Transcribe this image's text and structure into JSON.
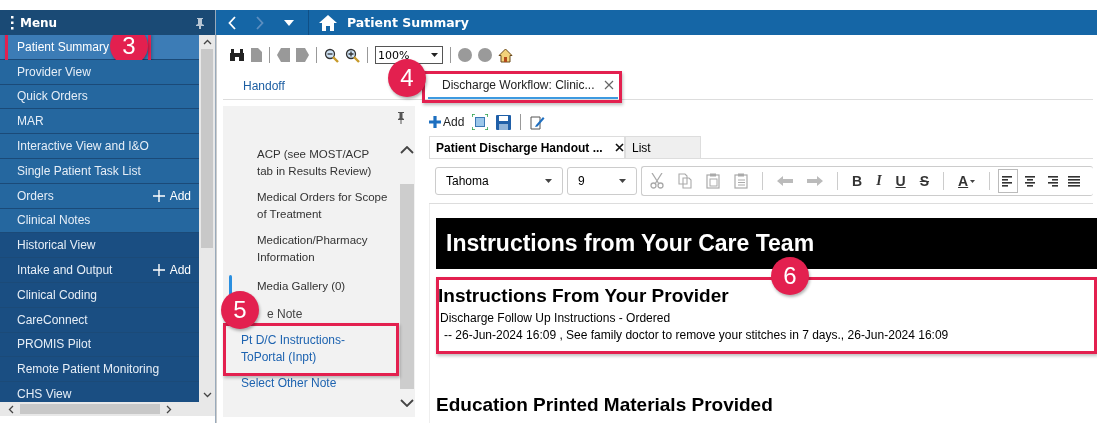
{
  "menu": {
    "title": "Menu",
    "items": [
      {
        "label": "Patient Summary",
        "selected": true,
        "kind": "primary",
        "callout": "3"
      },
      {
        "label": "Provider View",
        "selected": false,
        "kind": "primary"
      },
      {
        "label": "Quick Orders",
        "selected": false,
        "kind": "primary"
      },
      {
        "label": "MAR",
        "selected": false,
        "kind": "primary"
      },
      {
        "label": "Interactive View and I&O",
        "selected": false,
        "kind": "primary"
      },
      {
        "label": "Single Patient Task List",
        "selected": false,
        "kind": "primary"
      },
      {
        "label": "Orders",
        "selected": false,
        "kind": "primary",
        "action": "Add"
      },
      {
        "label": "Clinical Notes",
        "selected": false,
        "kind": "primary"
      },
      {
        "label": "Historical View",
        "selected": false,
        "kind": "secondary"
      },
      {
        "label": "Intake and Output",
        "selected": false,
        "kind": "secondary",
        "action": "Add"
      },
      {
        "label": "Clinical Coding",
        "selected": false,
        "kind": "secondary"
      },
      {
        "label": "CareConnect",
        "selected": false,
        "kind": "secondary"
      },
      {
        "label": "PROMIS Pilot",
        "selected": false,
        "kind": "secondary"
      },
      {
        "label": "Remote Patient Monitoring",
        "selected": false,
        "kind": "secondary"
      },
      {
        "label": "CHS View",
        "selected": false,
        "kind": "secondary"
      }
    ]
  },
  "header": {
    "title": "Patient Summary"
  },
  "toolbar": {
    "zoom": "100%"
  },
  "tabs": [
    {
      "label": "Handoff",
      "selected": false,
      "closable": false
    },
    {
      "label": "Discharge Workflow: Clinic...",
      "selected": true,
      "closable": true,
      "callout": "4"
    }
  ],
  "note_panel": {
    "items": [
      {
        "label": "ACP (see MOST/ACP tab in Results Review)",
        "selected": false
      },
      {
        "label": "Medical Orders for Scope of Treatment",
        "selected": false
      },
      {
        "label": "Medication/Pharmacy Information",
        "selected": false
      },
      {
        "label": "Media Gallery (0)",
        "selected": true
      }
    ],
    "section_title": "e Note",
    "note_link": "Pt D/C Instructions-ToPortal (Inpt)",
    "note_callout": "5",
    "select_link": "Select Other Note"
  },
  "document": {
    "add_label": "Add",
    "tabs": [
      {
        "label": "Patient Discharge Handout ...",
        "selected": true,
        "closable": true
      },
      {
        "label": "List",
        "selected": false,
        "closable": false
      }
    ],
    "font": "Tahoma",
    "size": "9",
    "format_buttons": [
      {
        "label": "B",
        "kind": "bold"
      },
      {
        "label": "I",
        "kind": "italic"
      },
      {
        "label": "U",
        "kind": "underline"
      },
      {
        "label": "S",
        "kind": "strike"
      },
      {
        "label": "A",
        "kind": "color"
      }
    ],
    "align_buttons": [
      {
        "kind": "left",
        "selected": true
      },
      {
        "kind": "center",
        "selected": false
      },
      {
        "kind": "right",
        "selected": false
      },
      {
        "kind": "justify",
        "selected": false
      }
    ],
    "banner": "Instructions from Your Care Team",
    "section": {
      "title": "Instructions From Your Provider",
      "order": "Discharge Follow Up Instructions - Ordered",
      "detail": "-- 26-Jun-2024 16:09 , See family doctor to remove your stitches in 7 days., 26-Jun-2024 16:09",
      "callout": "6"
    },
    "next_title": "Education Printed Materials Provided"
  }
}
